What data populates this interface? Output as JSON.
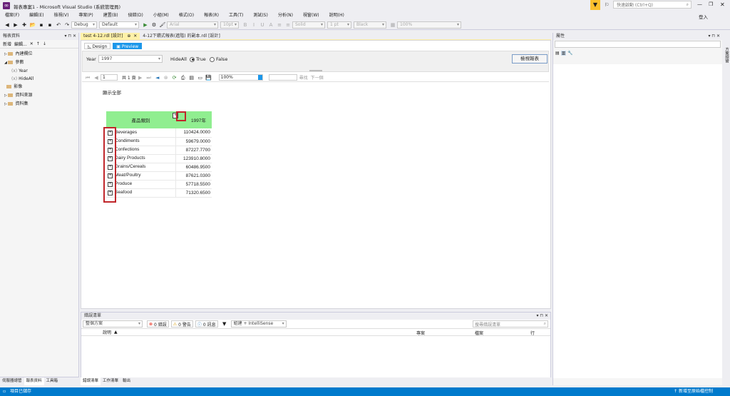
{
  "window": {
    "title": "報表專案1 - Microsoft Visual Studio (系統管理員)",
    "quick_launch": "快速啟動 (Ctrl+Q)",
    "login": "登入"
  },
  "menu": [
    "檔案(F)",
    "編輯(E)",
    "檢視(V)",
    "專案(P)",
    "建置(B)",
    "偵錯(D)",
    "小組(M)",
    "格式(O)",
    "報表(R)",
    "工具(T)",
    "測試(S)",
    "分析(N)",
    "視窗(W)",
    "說明(H)"
  ],
  "toolbar": {
    "config": "Debug",
    "platform": "Default",
    "font": "Arial",
    "size": "10pt",
    "border_style": "Solid",
    "border_width": "1 pt",
    "border_color": "Black",
    "zoom": "100%"
  },
  "left_panel": {
    "title": "報表資料",
    "new_label": "新增",
    "edit_label": "編輯...",
    "tree": [
      {
        "label": "內建欄位",
        "level": 0,
        "expand": "▷"
      },
      {
        "label": "參數",
        "level": 0,
        "expand": "◢"
      },
      {
        "label": "Year",
        "level": 1
      },
      {
        "label": "HideAll",
        "level": 1
      },
      {
        "label": "影像",
        "level": 0
      },
      {
        "label": "資料來源",
        "level": 0,
        "expand": "▷"
      },
      {
        "label": "資料集",
        "level": 0,
        "expand": "▷"
      }
    ],
    "bottom_tabs": [
      "伺服器總管",
      "報表資料",
      "工具箱"
    ]
  },
  "doc_tabs": [
    "test 4-12.rdl [設計]",
    "4-12下鑽式報表(進階) 的副本.rdl [設計]"
  ],
  "view_tabs": {
    "design": "Design",
    "preview": "Preview"
  },
  "params": {
    "year_label": "Year",
    "year_value": "1997",
    "hideall_label": "HideAll",
    "true_label": "True",
    "false_label": "False",
    "view_button": "檢視報表"
  },
  "report_toolbar": {
    "page": "1",
    "of_label": "共 1 頁",
    "zoom": "100%",
    "find": "尋找",
    "next": "下一個"
  },
  "report": {
    "show_all": "顯示全部",
    "col_category": "產品類別",
    "col_year": "1997年",
    "rows": [
      {
        "name": "Beverages",
        "value": "110424.0000"
      },
      {
        "name": "Condiments",
        "value": "59679.0000"
      },
      {
        "name": "Confections",
        "value": "87227.7700"
      },
      {
        "name": "Dairy Products",
        "value": "123910.8000"
      },
      {
        "name": "Grains/Cereals",
        "value": "60486.9500"
      },
      {
        "name": "Meat/Poultry",
        "value": "87621.0300"
      },
      {
        "name": "Produce",
        "value": "57718.5500"
      },
      {
        "name": "Seafood",
        "value": "71320.6500"
      }
    ]
  },
  "error_list": {
    "title": "錯誤清單",
    "scope": "整個方案",
    "errors": "0 錯誤",
    "warnings": "0 警告",
    "messages": "0 訊息",
    "build": "組建 + IntelliSense",
    "search": "搜尋錯誤清單",
    "col_desc": "說明",
    "col_project": "專案",
    "col_file": "檔案",
    "col_line": "行",
    "tabs": [
      "錯誤清單",
      "工作清單",
      "輸出"
    ]
  },
  "right_panel": {
    "title": "屬性",
    "side_tab": "方案總管"
  },
  "status": {
    "left": "項目已儲存",
    "right": "新增至原始檔控制"
  }
}
